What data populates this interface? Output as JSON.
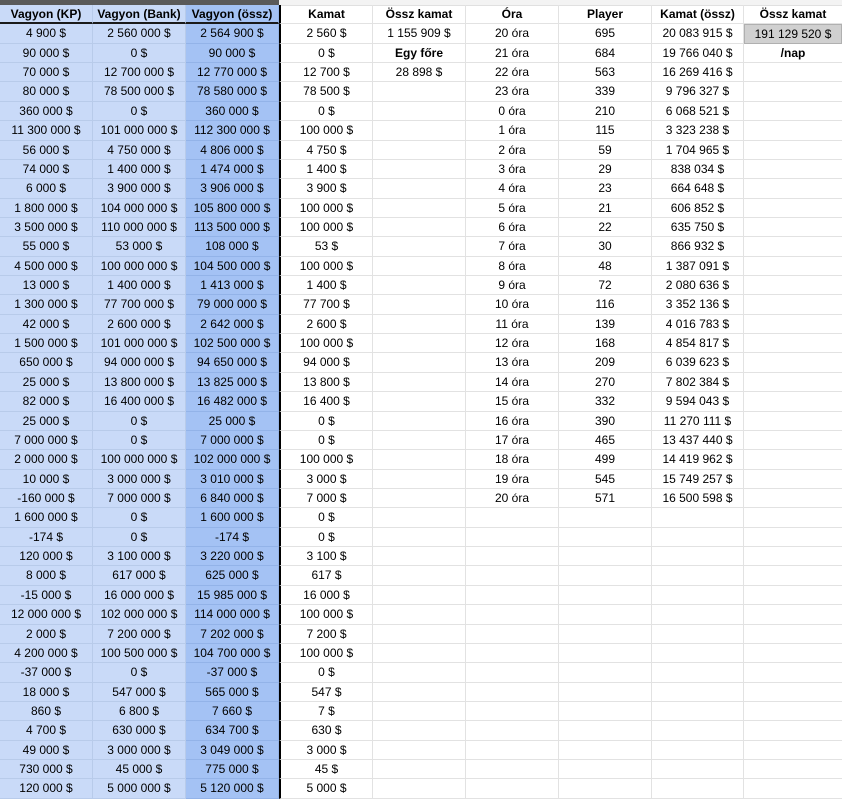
{
  "headers": [
    "Vagyon (KP)",
    "Vagyon (Bank)",
    "Vagyon (össz)",
    "Kamat",
    "Össz kamat",
    "Óra",
    "Player",
    "Kamat (össz)",
    "Össz kamat"
  ],
  "vagyon_kp": [
    "4 900 $",
    "90 000 $",
    "70 000 $",
    "80 000 $",
    "360 000 $",
    "11 300 000 $",
    "56 000 $",
    "74 000 $",
    "6 000 $",
    "1 800 000 $",
    "3 500 000 $",
    "55 000 $",
    "4 500 000 $",
    "13 000 $",
    "1 300 000 $",
    "42 000 $",
    "1 500 000 $",
    "650 000 $",
    "25 000 $",
    "82 000 $",
    "25 000 $",
    "7 000 000 $",
    "2 000 000 $",
    "10 000 $",
    "-160 000 $",
    "1 600 000 $",
    "-174 $",
    "120 000 $",
    "8 000 $",
    "-15 000 $",
    "12 000 000 $",
    "2 000 $",
    "4 200 000 $",
    "-37 000 $",
    "18 000 $",
    "860 $",
    "4 700 $",
    "49 000 $",
    "730 000 $",
    "120 000 $"
  ],
  "vagyon_bank": [
    "2 560 000 $",
    "0 $",
    "12 700 000 $",
    "78 500 000 $",
    "0 $",
    "101 000 000 $",
    "4 750 000 $",
    "1 400 000 $",
    "3 900 000 $",
    "104 000 000 $",
    "110 000 000 $",
    "53 000 $",
    "100 000 000 $",
    "1 400 000 $",
    "77 700 000 $",
    "2 600 000 $",
    "101 000 000 $",
    "94 000 000 $",
    "13 800 000 $",
    "16 400 000 $",
    "0 $",
    "0 $",
    "100 000 000 $",
    "3 000 000 $",
    "7 000 000 $",
    "0 $",
    "0 $",
    "3 100 000 $",
    "617 000 $",
    "16 000 000 $",
    "102 000 000 $",
    "7 200 000 $",
    "100 500 000 $",
    "0 $",
    "547 000 $",
    "6 800 $",
    "630 000 $",
    "3 000 000 $",
    "45 000 $",
    "5 000 000 $"
  ],
  "vagyon_ossz": [
    "2 564 900 $",
    "90 000 $",
    "12 770 000 $",
    "78 580 000 $",
    "360 000 $",
    "112 300 000 $",
    "4 806 000 $",
    "1 474 000 $",
    "3 906 000 $",
    "105 800 000 $",
    "113 500 000 $",
    "108 000 $",
    "104 500 000 $",
    "1 413 000 $",
    "79 000 000 $",
    "2 642 000 $",
    "102 500 000 $",
    "94 650 000 $",
    "13 825 000 $",
    "16 482 000 $",
    "25 000 $",
    "7 000 000 $",
    "102 000 000 $",
    "3 010 000 $",
    "6 840 000 $",
    "1 600 000 $",
    "-174 $",
    "3 220 000 $",
    "625 000 $",
    "15 985 000 $",
    "114 000 000 $",
    "7 202 000 $",
    "104 700 000 $",
    "-37 000 $",
    "565 000 $",
    "7 660 $",
    "634 700 $",
    "3 049 000 $",
    "775 000 $",
    "5 120 000 $"
  ],
  "kamat": [
    "2 560 $",
    "0 $",
    "12 700 $",
    "78 500 $",
    "0 $",
    "100 000 $",
    "4 750 $",
    "1 400 $",
    "3 900 $",
    "100 000 $",
    "100 000 $",
    "53 $",
    "100 000 $",
    "1 400 $",
    "77 700 $",
    "2 600 $",
    "100 000 $",
    "94 000 $",
    "13 800 $",
    "16 400 $",
    "0 $",
    "0 $",
    "100 000 $",
    "3 000 $",
    "7 000 $",
    "0 $",
    "0 $",
    "3 100 $",
    "617 $",
    "16 000 $",
    "100 000 $",
    "7 200 $",
    "100 000 $",
    "0 $",
    "547 $",
    "7 $",
    "630 $",
    "3 000 $",
    "45 $",
    "5 000 $"
  ],
  "ossz_kamat_col": [
    "1 155 909 $",
    "Egy főre",
    "28 898 $"
  ],
  "ora": [
    "20 óra",
    "21 óra",
    "22 óra",
    "23 óra",
    "0 óra",
    "1 óra",
    "2 óra",
    "3 óra",
    "4 óra",
    "5 óra",
    "6 óra",
    "7 óra",
    "8 óra",
    "9 óra",
    "10 óra",
    "11 óra",
    "12 óra",
    "13 óra",
    "14 óra",
    "15 óra",
    "16 óra",
    "17 óra",
    "18 óra",
    "19 óra",
    "20 óra"
  ],
  "player": [
    "695",
    "684",
    "563",
    "339",
    "210",
    "115",
    "59",
    "29",
    "23",
    "21",
    "22",
    "30",
    "48",
    "72",
    "116",
    "139",
    "168",
    "209",
    "270",
    "332",
    "390",
    "465",
    "499",
    "545",
    "571"
  ],
  "kamat_ossz": [
    "20 083 915 $",
    "19 766 040 $",
    "16 269 416 $",
    "9 796 327 $",
    "6 068 521 $",
    "3 323 238 $",
    "1 704 965 $",
    "838 034 $",
    "664 648 $",
    "606 852 $",
    "635 750 $",
    "866 932 $",
    "1 387 091 $",
    "2 080 636 $",
    "3 352 136 $",
    "4 016 783 $",
    "4 854 817 $",
    "6 039 623 $",
    "7 802 384 $",
    "9 594 043 $",
    "11 270 111 $",
    "13 437 440 $",
    "14 419 962 $",
    "15 749 257 $",
    "16 500 598 $"
  ],
  "ossz_kamat_total": [
    "191 129 520 $",
    "/nap"
  ]
}
